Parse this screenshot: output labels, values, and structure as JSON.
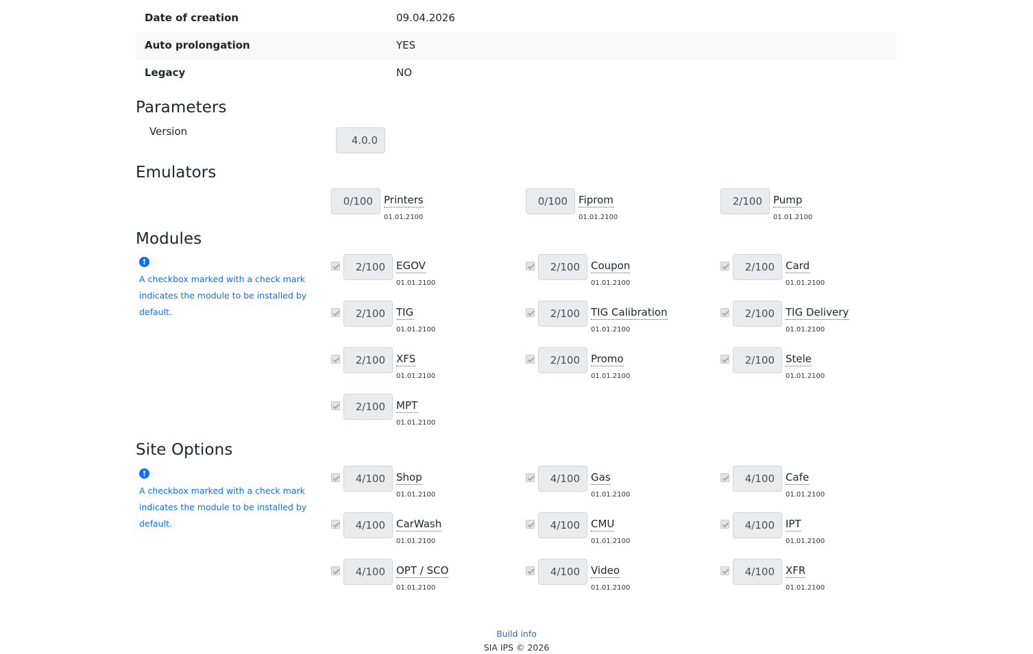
{
  "info": [
    {
      "label": "Date of creation",
      "value": "09.04.2026"
    },
    {
      "label": "Auto prolongation",
      "value": "YES"
    },
    {
      "label": "Legacy",
      "value": "NO"
    }
  ],
  "parameters": {
    "title": "Parameters",
    "version_label": "Version",
    "version_value": "4.0.0"
  },
  "emulators": {
    "title": "Emulators",
    "items": [
      {
        "count": "0/100",
        "name": "Printers",
        "date": "01.01.2100"
      },
      {
        "count": "0/100",
        "name": "Fiprom",
        "date": "01.01.2100"
      },
      {
        "count": "2/100",
        "name": "Pump",
        "date": "01.01.2100"
      }
    ]
  },
  "modules": {
    "title": "Modules",
    "hint_icon": "!",
    "hint_line1": "A checkbox marked with a check mark",
    "hint_line2": "indicates the module to be installed by default.",
    "items": [
      {
        "count": "2/100",
        "name": "EGOV",
        "date": "01.01.2100"
      },
      {
        "count": "2/100",
        "name": "Coupon",
        "date": "01.01.2100"
      },
      {
        "count": "2/100",
        "name": "Card",
        "date": "01.01.2100"
      },
      {
        "count": "2/100",
        "name": "TIG",
        "date": "01.01.2100"
      },
      {
        "count": "2/100",
        "name": "TIG Calibration",
        "date": "01.01.2100"
      },
      {
        "count": "2/100",
        "name": "TIG Delivery",
        "date": "01.01.2100"
      },
      {
        "count": "2/100",
        "name": "XFS",
        "date": "01.01.2100"
      },
      {
        "count": "2/100",
        "name": "Promo",
        "date": "01.01.2100"
      },
      {
        "count": "2/100",
        "name": "Stele",
        "date": "01.01.2100"
      },
      {
        "count": "2/100",
        "name": "MPT",
        "date": "01.01.2100"
      }
    ]
  },
  "site_options": {
    "title": "Site Options",
    "hint_icon": "!",
    "hint_line1": "A checkbox marked with a check mark",
    "hint_line2": "indicates the module to be installed by default.",
    "items": [
      {
        "count": "4/100",
        "name": "Shop",
        "date": "01.01.2100"
      },
      {
        "count": "4/100",
        "name": "Gas",
        "date": "01.01.2100"
      },
      {
        "count": "4/100",
        "name": "Cafe",
        "date": "01.01.2100"
      },
      {
        "count": "4/100",
        "name": "CarWash",
        "date": "01.01.2100"
      },
      {
        "count": "4/100",
        "name": "CMU",
        "date": "01.01.2100"
      },
      {
        "count": "4/100",
        "name": "IPT",
        "date": "01.01.2100"
      },
      {
        "count": "4/100",
        "name": "OPT / SCO",
        "date": "01.01.2100"
      },
      {
        "count": "4/100",
        "name": "Video",
        "date": "01.01.2100"
      },
      {
        "count": "4/100",
        "name": "XFR",
        "date": "01.01.2100"
      }
    ]
  },
  "footer": {
    "build_info": "Build info",
    "copyright": "SIA IPS © 2026"
  }
}
